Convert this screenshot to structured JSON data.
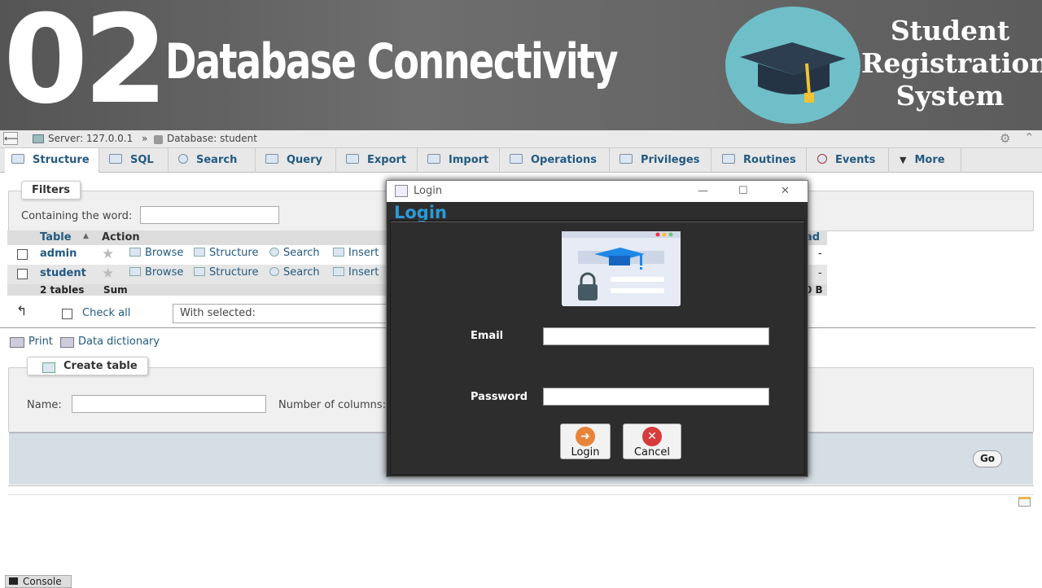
{
  "banner": {
    "episode_number": "02",
    "title": "Database Connectivity",
    "logo_text": [
      "Student",
      "Registration",
      "System"
    ]
  },
  "pma": {
    "breadcrumb": {
      "server_label": "Server: 127.0.0.1",
      "separator": "»",
      "database_label": "Database: student"
    },
    "tabs": [
      {
        "label": "Structure",
        "icon": "structure-icon",
        "active": true
      },
      {
        "label": "SQL",
        "icon": "sql-icon"
      },
      {
        "label": "Search",
        "icon": "search-icon"
      },
      {
        "label": "Query",
        "icon": "query-icon"
      },
      {
        "label": "Export",
        "icon": "export-icon"
      },
      {
        "label": "Import",
        "icon": "import-icon"
      },
      {
        "label": "Operations",
        "icon": "wrench-icon"
      },
      {
        "label": "Privileges",
        "icon": "privileges-icon"
      },
      {
        "label": "Routines",
        "icon": "routines-icon"
      },
      {
        "label": "Events",
        "icon": "clock-icon"
      },
      {
        "label": "More",
        "icon": "chevron-down-icon"
      }
    ],
    "filters": {
      "legend": "Filters",
      "containing_label": "Containing the word:",
      "containing_value": ""
    },
    "table": {
      "headers": {
        "table": "Table",
        "action": "Action",
        "overhead_partial": "ad"
      },
      "rows": [
        {
          "name": "admin",
          "actions": [
            "Browse",
            "Structure",
            "Search",
            "Insert"
          ],
          "overhead": "-"
        },
        {
          "name": "student",
          "actions": [
            "Browse",
            "Structure",
            "Search",
            "Insert"
          ],
          "overhead": "-"
        }
      ],
      "summary": {
        "count": "2 tables",
        "sum": "Sum",
        "size_partial": "0 B"
      }
    },
    "bulk": {
      "check_all": "Check all",
      "with_selected": "With selected:"
    },
    "links": {
      "print": "Print",
      "data_dictionary": "Data dictionary"
    },
    "create_table": {
      "legend": "Create table",
      "name_label": "Name:",
      "name_value": "",
      "columns_label": "Number of columns:",
      "go": "Go"
    },
    "console": "Console"
  },
  "dialog": {
    "window_title": "Login",
    "heading": "Login",
    "email_label": "Email",
    "email_value": "",
    "password_label": "Password",
    "password_value": "",
    "login_button": "Login",
    "cancel_button": "Cancel",
    "controls": {
      "minimize": "—",
      "maximize": "☐",
      "close": "✕"
    }
  },
  "colors": {
    "banner_bg": "#636363",
    "logo_circle": "#6fbfc8",
    "pma_link": "#235a81",
    "dialog_bg": "#2d2d2d",
    "dialog_heading": "#2a9ad8"
  }
}
